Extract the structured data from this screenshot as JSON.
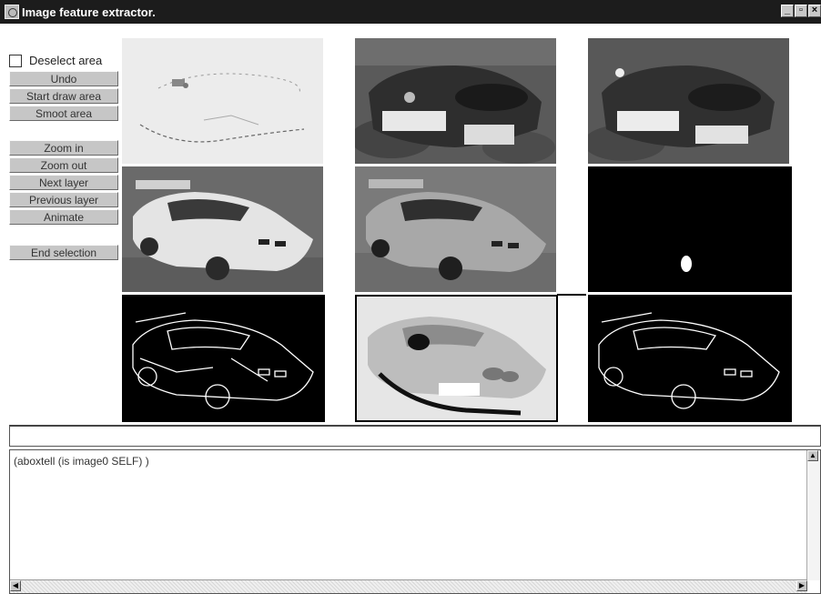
{
  "window": {
    "title": "Image feature extractor.",
    "icons": [
      "app-icon",
      "minimize-icon",
      "maximize-icon",
      "close-icon"
    ]
  },
  "controls": {
    "deselect_label": "Deselect area",
    "deselect_checked": false,
    "buttons": [
      {
        "id": "undo",
        "label": "Undo"
      },
      {
        "id": "start-draw-area",
        "label": "Start draw area"
      },
      {
        "id": "smoot-area",
        "label": "Smoot area"
      },
      {
        "id": "zoom-in",
        "label": "Zoom in"
      },
      {
        "id": "zoom-out",
        "label": "Zoom out"
      },
      {
        "id": "next-layer",
        "label": "Next layer"
      },
      {
        "id": "previous-layer",
        "label": "Previous layer"
      },
      {
        "id": "animate",
        "label": "Animate"
      },
      {
        "id": "end-selection",
        "label": "End selection"
      }
    ]
  },
  "images": [
    "gradient-edges-layer",
    "segmented-layer-1",
    "segmented-layer-2",
    "smoothed-car",
    "original-car-photo",
    "selection-mask",
    "edge-map",
    "region-map",
    "contour-map"
  ],
  "command": {
    "input_value": "",
    "output": "(aboxtell (is image0 SELF) )"
  }
}
